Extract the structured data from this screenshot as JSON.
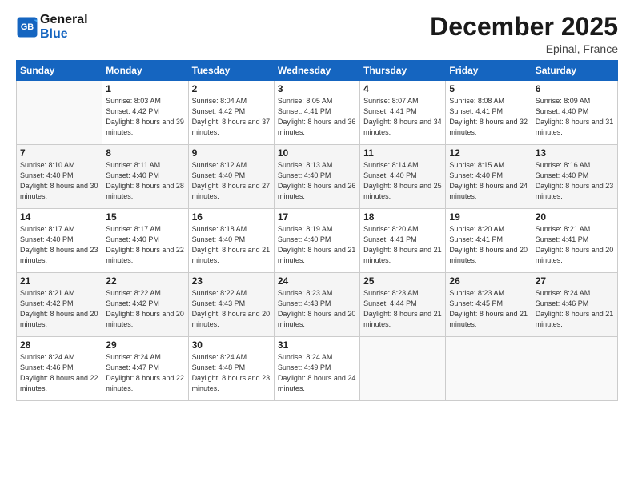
{
  "header": {
    "logo_line1": "General",
    "logo_line2": "Blue",
    "title": "December 2025",
    "subtitle": "Epinal, France"
  },
  "columns": [
    "Sunday",
    "Monday",
    "Tuesday",
    "Wednesday",
    "Thursday",
    "Friday",
    "Saturday"
  ],
  "weeks": [
    [
      {
        "day": "",
        "info": ""
      },
      {
        "day": "1",
        "info": "Sunrise: 8:03 AM\nSunset: 4:42 PM\nDaylight: 8 hours\nand 39 minutes."
      },
      {
        "day": "2",
        "info": "Sunrise: 8:04 AM\nSunset: 4:42 PM\nDaylight: 8 hours\nand 37 minutes."
      },
      {
        "day": "3",
        "info": "Sunrise: 8:05 AM\nSunset: 4:41 PM\nDaylight: 8 hours\nand 36 minutes."
      },
      {
        "day": "4",
        "info": "Sunrise: 8:07 AM\nSunset: 4:41 PM\nDaylight: 8 hours\nand 34 minutes."
      },
      {
        "day": "5",
        "info": "Sunrise: 8:08 AM\nSunset: 4:41 PM\nDaylight: 8 hours\nand 32 minutes."
      },
      {
        "day": "6",
        "info": "Sunrise: 8:09 AM\nSunset: 4:40 PM\nDaylight: 8 hours\nand 31 minutes."
      }
    ],
    [
      {
        "day": "7",
        "info": "Sunrise: 8:10 AM\nSunset: 4:40 PM\nDaylight: 8 hours\nand 30 minutes."
      },
      {
        "day": "8",
        "info": "Sunrise: 8:11 AM\nSunset: 4:40 PM\nDaylight: 8 hours\nand 28 minutes."
      },
      {
        "day": "9",
        "info": "Sunrise: 8:12 AM\nSunset: 4:40 PM\nDaylight: 8 hours\nand 27 minutes."
      },
      {
        "day": "10",
        "info": "Sunrise: 8:13 AM\nSunset: 4:40 PM\nDaylight: 8 hours\nand 26 minutes."
      },
      {
        "day": "11",
        "info": "Sunrise: 8:14 AM\nSunset: 4:40 PM\nDaylight: 8 hours\nand 25 minutes."
      },
      {
        "day": "12",
        "info": "Sunrise: 8:15 AM\nSunset: 4:40 PM\nDaylight: 8 hours\nand 24 minutes."
      },
      {
        "day": "13",
        "info": "Sunrise: 8:16 AM\nSunset: 4:40 PM\nDaylight: 8 hours\nand 23 minutes."
      }
    ],
    [
      {
        "day": "14",
        "info": "Sunrise: 8:17 AM\nSunset: 4:40 PM\nDaylight: 8 hours\nand 23 minutes."
      },
      {
        "day": "15",
        "info": "Sunrise: 8:17 AM\nSunset: 4:40 PM\nDaylight: 8 hours\nand 22 minutes."
      },
      {
        "day": "16",
        "info": "Sunrise: 8:18 AM\nSunset: 4:40 PM\nDaylight: 8 hours\nand 21 minutes."
      },
      {
        "day": "17",
        "info": "Sunrise: 8:19 AM\nSunset: 4:40 PM\nDaylight: 8 hours\nand 21 minutes."
      },
      {
        "day": "18",
        "info": "Sunrise: 8:20 AM\nSunset: 4:41 PM\nDaylight: 8 hours\nand 21 minutes."
      },
      {
        "day": "19",
        "info": "Sunrise: 8:20 AM\nSunset: 4:41 PM\nDaylight: 8 hours\nand 20 minutes."
      },
      {
        "day": "20",
        "info": "Sunrise: 8:21 AM\nSunset: 4:41 PM\nDaylight: 8 hours\nand 20 minutes."
      }
    ],
    [
      {
        "day": "21",
        "info": "Sunrise: 8:21 AM\nSunset: 4:42 PM\nDaylight: 8 hours\nand 20 minutes."
      },
      {
        "day": "22",
        "info": "Sunrise: 8:22 AM\nSunset: 4:42 PM\nDaylight: 8 hours\nand 20 minutes."
      },
      {
        "day": "23",
        "info": "Sunrise: 8:22 AM\nSunset: 4:43 PM\nDaylight: 8 hours\nand 20 minutes."
      },
      {
        "day": "24",
        "info": "Sunrise: 8:23 AM\nSunset: 4:43 PM\nDaylight: 8 hours\nand 20 minutes."
      },
      {
        "day": "25",
        "info": "Sunrise: 8:23 AM\nSunset: 4:44 PM\nDaylight: 8 hours\nand 21 minutes."
      },
      {
        "day": "26",
        "info": "Sunrise: 8:23 AM\nSunset: 4:45 PM\nDaylight: 8 hours\nand 21 minutes."
      },
      {
        "day": "27",
        "info": "Sunrise: 8:24 AM\nSunset: 4:46 PM\nDaylight: 8 hours\nand 21 minutes."
      }
    ],
    [
      {
        "day": "28",
        "info": "Sunrise: 8:24 AM\nSunset: 4:46 PM\nDaylight: 8 hours\nand 22 minutes."
      },
      {
        "day": "29",
        "info": "Sunrise: 8:24 AM\nSunset: 4:47 PM\nDaylight: 8 hours\nand 22 minutes."
      },
      {
        "day": "30",
        "info": "Sunrise: 8:24 AM\nSunset: 4:48 PM\nDaylight: 8 hours\nand 23 minutes."
      },
      {
        "day": "31",
        "info": "Sunrise: 8:24 AM\nSunset: 4:49 PM\nDaylight: 8 hours\nand 24 minutes."
      },
      {
        "day": "",
        "info": ""
      },
      {
        "day": "",
        "info": ""
      },
      {
        "day": "",
        "info": ""
      }
    ]
  ]
}
